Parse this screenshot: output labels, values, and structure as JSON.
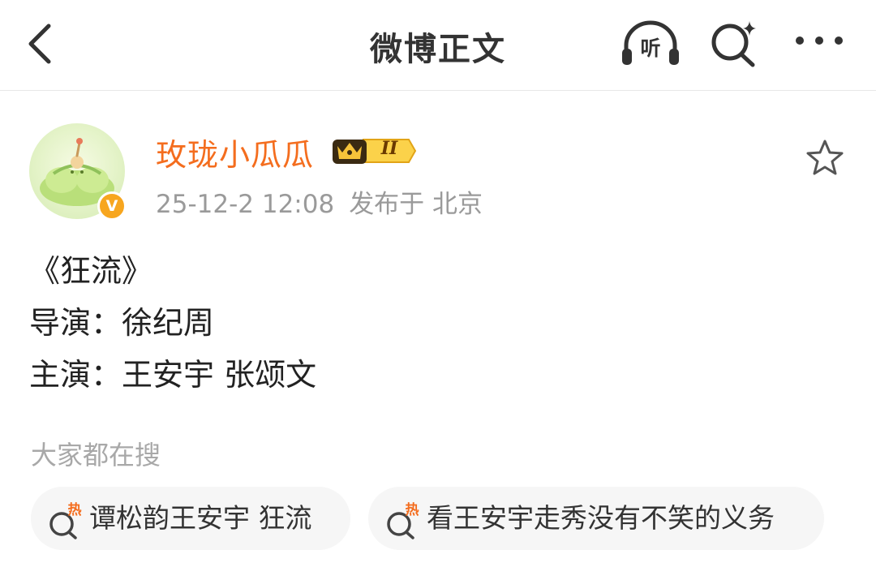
{
  "nav": {
    "title": "微博正文",
    "listen_label": "听",
    "icons": [
      "back-arrow-icon",
      "listen-headphone-icon",
      "search-spark-icon",
      "more-dots-icon"
    ]
  },
  "post": {
    "author": {
      "name": "玫珑小瓜瓜",
      "member_level": "II",
      "verified_mark": "V",
      "avatar": "melon-avatar"
    },
    "timestamp": "25-12-2 12:08",
    "location": "发布于 北京",
    "body_lines": [
      "《狂流》",
      "导演：徐纪周",
      "主演：王安宇 张颂文"
    ]
  },
  "trending": {
    "title": "大家都在搜",
    "hot_label": "热",
    "items": [
      {
        "text": "谭松韵王安宇 狂流"
      },
      {
        "text": "看王安宇走秀没有不笑的义务"
      }
    ]
  },
  "colors": {
    "username": "#f46d1e",
    "meta": "#9a9a9a",
    "hot_accent": "#f46d1e",
    "chip_bg": "#f6f6f6",
    "verified_badge": "#f7a61f"
  }
}
